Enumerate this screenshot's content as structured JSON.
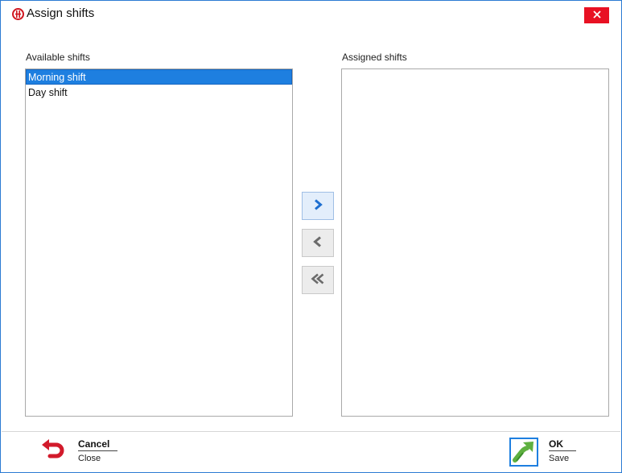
{
  "window": {
    "title": "Assign shifts",
    "accent_color": "#2b7bd3",
    "close_icon": "close-icon",
    "app_icon": "shifts-app-icon"
  },
  "available": {
    "label": "Available shifts",
    "items": [
      {
        "label": "Morning shift",
        "selected": true
      },
      {
        "label": "Day shift",
        "selected": false
      }
    ]
  },
  "assigned": {
    "label": "Assigned shifts",
    "items": []
  },
  "transfer": {
    "add_icon": "chevron-right-icon",
    "remove_icon": "chevron-left-icon",
    "remove_all_icon": "double-chevron-left-icon"
  },
  "footer": {
    "cancel": {
      "title": "Cancel",
      "subtitle": "Close",
      "icon": "undo-arrow-icon"
    },
    "ok": {
      "title": "OK",
      "subtitle": "Save",
      "icon": "ok-arrow-icon"
    }
  },
  "colors": {
    "selection": "#1e7fe0",
    "close_button": "#e81123",
    "chevron_active": "#1e6fd0",
    "chevron_inactive": "#6b6b6b"
  }
}
